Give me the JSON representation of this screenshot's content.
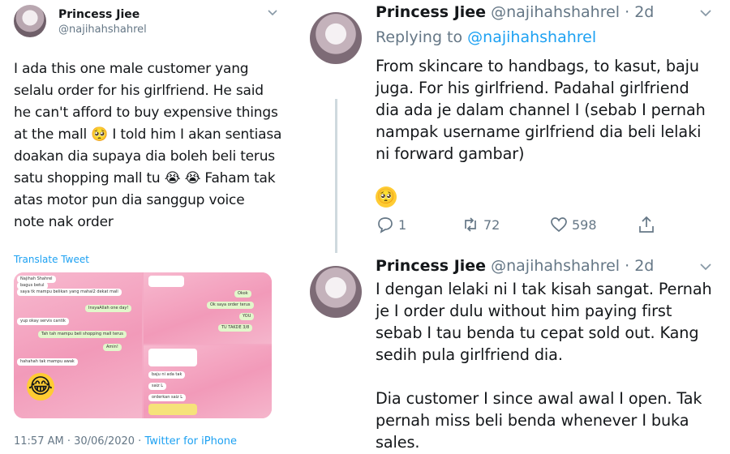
{
  "left_tweet": {
    "name": "Princess Jiee",
    "handle": "@najihahshahrel",
    "lines": [
      "I ada this one male customer yang",
      "selalu order for his girlfriend. He said",
      "he can't afford to buy expensive things",
      "at the mall 🥺  I told him I akan sentiasa",
      "doakan dia supaya dia boleh beli terus",
      "satu shopping mall tu 😭 😭  Faham tak",
      "atas motor pun dia sanggup voice",
      "note nak order"
    ],
    "translate_label": "Translate Tweet",
    "timestamp": "11:57 AM · 30/06/2020 · ",
    "source": "Twitter for iPhone",
    "media": {
      "panel1_bubbles": [
        "Najihah Shahrel",
        "bagus betul",
        "saya tk mampu belikan yang mahal2 dekat mall",
        "InsyaAllah one day!",
        "yup okay servis cantik",
        "Tah tah mampu beli shopping mall terus",
        "Amin!",
        "hahahah tak mampu awak"
      ],
      "panel2_bubbles": [
        "Okok",
        "Ok saya order terus",
        "YOU",
        "TU TAKDE 3/8"
      ],
      "panel3_bubbles": [
        "baju ni ada tak",
        "saiz L",
        "orderkan saiz L"
      ],
      "emoji": "😂"
    }
  },
  "right_tweets": [
    {
      "name": "Princess Jiee",
      "handle": "@najihahshahrel · 2d",
      "replying_prefix": "Replying to ",
      "replying_to": "@najihahshahrel",
      "lines": [
        "From skincare to handbags, to kasut, baju",
        "juga. For his girlfriend. Padahal girlfriend",
        "dia ada je dalam channel I (sebab I pernah",
        "nampak username girlfriend dia beli lelaki",
        "ni forward gambar)"
      ],
      "emoji": "🥺",
      "reply_count": "1",
      "retweet_count": "72",
      "like_count": "598"
    },
    {
      "name": "Princess Jiee",
      "handle": "@najihahshahrel · 2d",
      "lines": [
        "I dengan lelaki ni I tak kisah sangat. Pernah",
        "je I order dulu without him paying first",
        "sebab I tau benda tu cepat sold out. Kang",
        "sedih pula girlfriend dia.",
        "",
        "Dia customer I since awal awal I open. Tak",
        "pernah miss beli benda whenever I buka",
        "sales."
      ]
    }
  ],
  "icons": {
    "chevron": "chevron-down-icon",
    "reply": "reply-icon",
    "retweet": "retweet-icon",
    "like": "heart-icon",
    "share": "share-icon"
  },
  "colors": {
    "text": "#14171a",
    "secondary": "#657786",
    "link": "#1da1f2",
    "media_pink": "#f4a9c4"
  }
}
